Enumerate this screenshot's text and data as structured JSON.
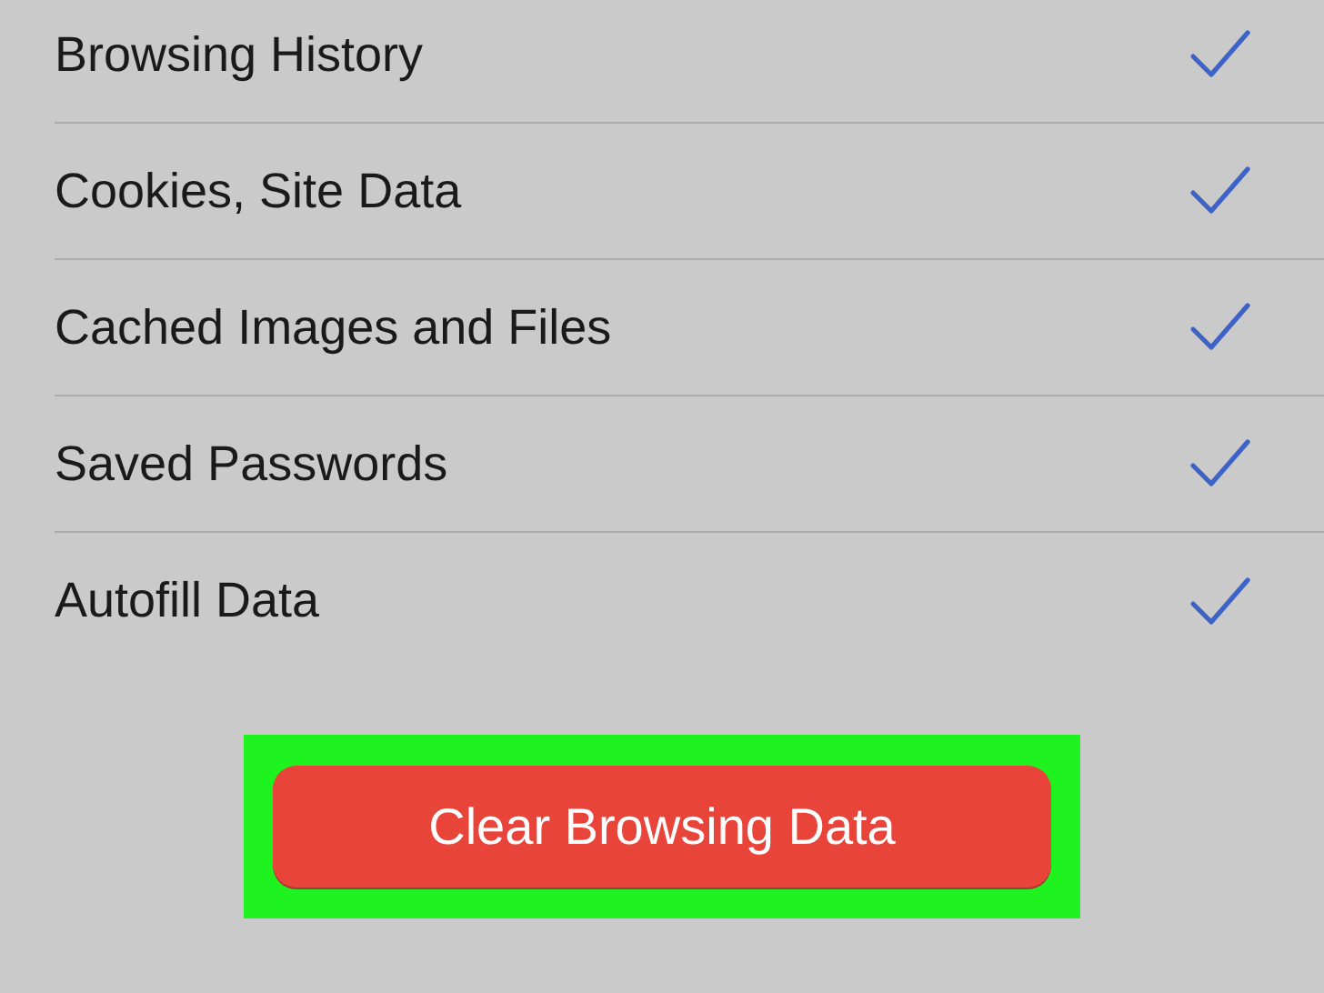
{
  "items": [
    {
      "label": "Browsing History",
      "checked": true
    },
    {
      "label": "Cookies, Site Data",
      "checked": true
    },
    {
      "label": "Cached Images and Files",
      "checked": true
    },
    {
      "label": "Saved Passwords",
      "checked": true
    },
    {
      "label": "Autofill Data",
      "checked": true
    }
  ],
  "action_button": {
    "label": "Clear Browsing Data",
    "highlighted": true
  }
}
